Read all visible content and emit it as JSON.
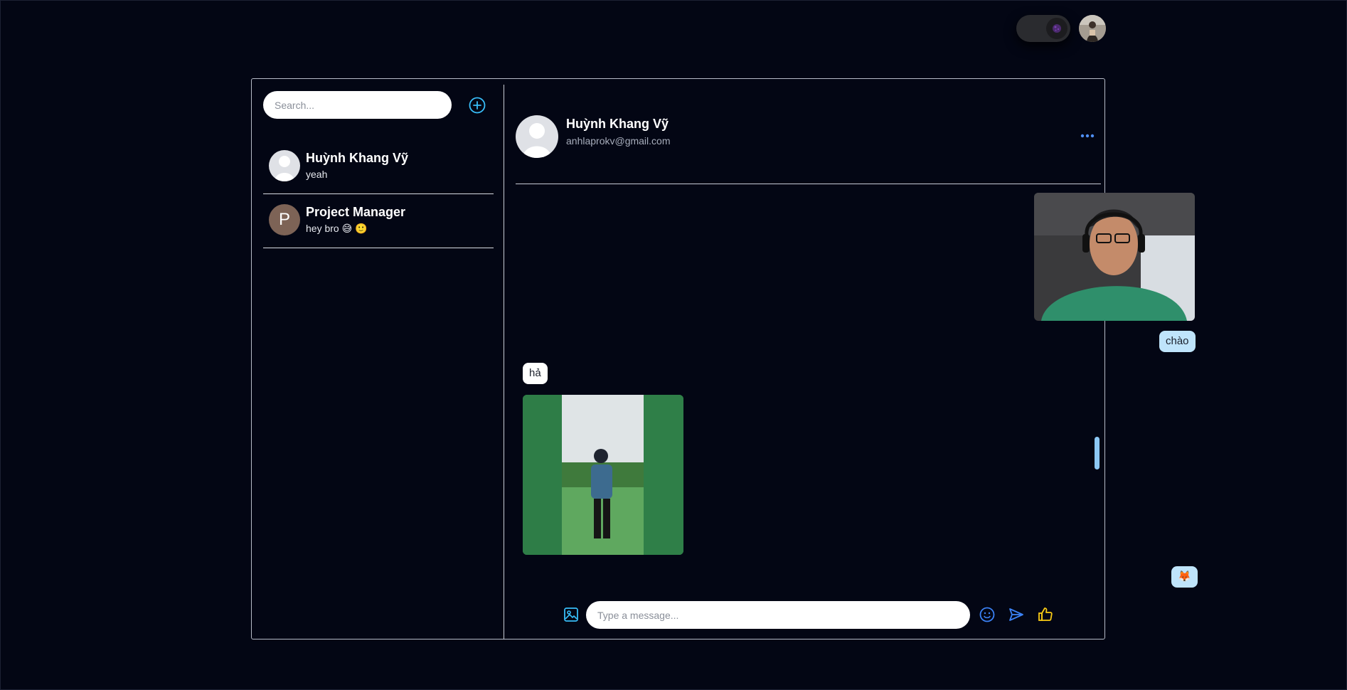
{
  "header": {
    "theme_toggle_icon": "moon-icon",
    "user_avatar_icon": "user-avatar"
  },
  "sidebar": {
    "search_placeholder": "Search...",
    "add_icon": "plus-circle-icon",
    "conversations": [
      {
        "name": "Huỳnh Khang Vỹ",
        "last_message": "yeah",
        "avatar": "default-avatar"
      },
      {
        "name": "Project Manager",
        "last_message": "hey bro 😅 🙂",
        "avatar_letter": "P"
      }
    ]
  },
  "chat": {
    "contact_name": "Huỳnh Khang Vỹ",
    "contact_email": "anhlaprokv@gmail.com",
    "more_icon": "more-horizontal-icon",
    "messages": [
      {
        "from": "me",
        "type": "image",
        "description": "photo"
      },
      {
        "from": "me",
        "type": "text",
        "text": "chào"
      },
      {
        "from": "them",
        "type": "text",
        "text": "hả"
      },
      {
        "from": "them",
        "type": "image",
        "description": "photo"
      },
      {
        "from": "me",
        "type": "text",
        "text": "🦊"
      }
    ],
    "composer": {
      "placeholder": "Type a message...",
      "image_icon": "image-icon",
      "emoji_icon": "smile-icon",
      "send_icon": "send-icon",
      "like_icon": "thumbs-up-icon"
    }
  },
  "colors": {
    "background": "#030614",
    "accent_blue": "#3b82f6",
    "cyan": "#38bdf8",
    "like_yellow": "#facc15",
    "bubble_me": "#bfe4fb"
  }
}
